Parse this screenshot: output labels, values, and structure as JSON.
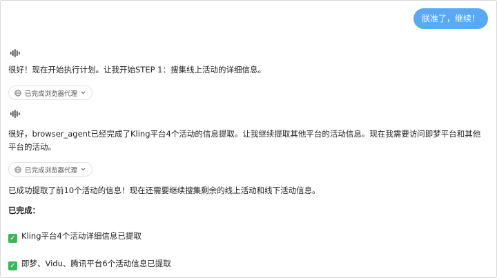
{
  "user_message": "朕准了，继续！",
  "messages": [
    {
      "text": "很好！现在开始执行计划。让我开始STEP 1：搜集线上活动的详细信息。",
      "chip": "已完成浏览器代理"
    },
    {
      "text": "很好，browser_agent已经完成了Kling平台4个活动的信息提取。让我继续提取其他平台的活动信息。现在我需要访问即梦平台和其他平台的活动。",
      "chip": "已完成浏览器代理"
    }
  ],
  "summary_text": "已成功提取了前10个活动的信息！现在还需要继续搜集剩余的线上活动和线下活动信息。",
  "completed_heading": "已完成：",
  "completed_items": [
    "Kling平台4个活动详细信息已提取",
    "即梦、Vidu、腾讯平台6个活动信息已提取"
  ],
  "colors": {
    "user_bubble": "#5aa9f5",
    "check": "#3fb45a"
  },
  "icons": {
    "agent": "soundwave-icon",
    "chip": "globe-icon",
    "chip_toggle": "chevron-down-icon",
    "done": "check-box-icon"
  }
}
